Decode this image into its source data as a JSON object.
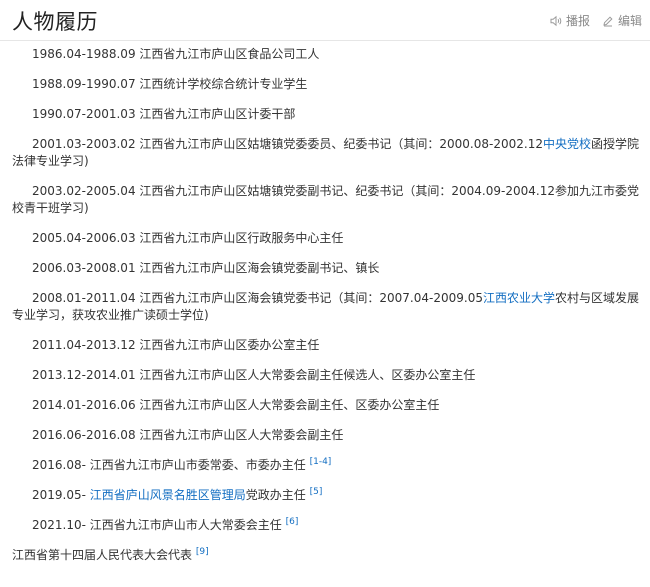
{
  "header": {
    "title": "人物履历",
    "actions": [
      {
        "label": "播报",
        "icon": "speaker-icon"
      },
      {
        "label": "编辑",
        "icon": "pencil-icon"
      }
    ]
  },
  "entries": [
    {
      "parts": [
        {
          "text": "1986.04-1988.09 江西省九江市庐山区食品公司工人"
        }
      ]
    },
    {
      "parts": [
        {
          "text": "1988.09-1990.07 江西统计学校综合统计专业学生"
        }
      ]
    },
    {
      "parts": [
        {
          "text": "1990.07-2001.03 江西省九江市庐山区计委干部"
        }
      ]
    },
    {
      "parts": [
        {
          "text": "2001.03-2003.02 江西省九江市庐山区姑塘镇党委委员、纪委书记（其间：2000.08-2002.12"
        },
        {
          "link": "中央党校"
        },
        {
          "text": "函授学院法律专业学习)"
        }
      ]
    },
    {
      "parts": [
        {
          "text": "2003.02-2005.04 江西省九江市庐山区姑塘镇党委副书记、纪委书记（其间：2004.09-2004.12参加九江市委党校青干班学习)"
        }
      ]
    },
    {
      "parts": [
        {
          "text": "2005.04-2006.03 江西省九江市庐山区行政服务中心主任"
        }
      ]
    },
    {
      "parts": [
        {
          "text": "2006.03-2008.01 江西省九江市庐山区海会镇党委副书记、镇长"
        }
      ]
    },
    {
      "parts": [
        {
          "text": "2008.01-2011.04 江西省九江市庐山区海会镇党委书记（其间：2007.04-2009.05"
        },
        {
          "link": "江西农业大学"
        },
        {
          "text": "农村与区域发展专业学习，获攻农业推广读硕士学位)"
        }
      ]
    },
    {
      "parts": [
        {
          "text": "2011.04-2013.12 江西省九江市庐山区委办公室主任"
        }
      ]
    },
    {
      "parts": [
        {
          "text": "2013.12-2014.01 江西省九江市庐山区人大常委会副主任候选人、区委办公室主任"
        }
      ]
    },
    {
      "parts": [
        {
          "text": "2014.01-2016.06 江西省九江市庐山区人大常委会副主任、区委办公室主任"
        }
      ]
    },
    {
      "parts": [
        {
          "text": "2016.06-2016.08 江西省九江市庐山区人大常委会副主任"
        }
      ]
    },
    {
      "parts": [
        {
          "text": "2016.08- 江西省九江市庐山市委常委、市委办主任 "
        },
        {
          "sup": "[1-4]"
        }
      ]
    },
    {
      "parts": [
        {
          "text": "2019.05- "
        },
        {
          "link": "江西省庐山风景名胜区管理局"
        },
        {
          "text": "党政办主任 "
        },
        {
          "sup": "[5]"
        }
      ]
    },
    {
      "parts": [
        {
          "text": "2021.10- 江西省九江市庐山市人大常委会主任 "
        },
        {
          "sup": "[6]"
        }
      ]
    },
    {
      "parts": [
        {
          "text": "江西省第十四届人民代表大会代表 "
        },
        {
          "sup": "[9]"
        }
      ],
      "noindent": true
    }
  ]
}
